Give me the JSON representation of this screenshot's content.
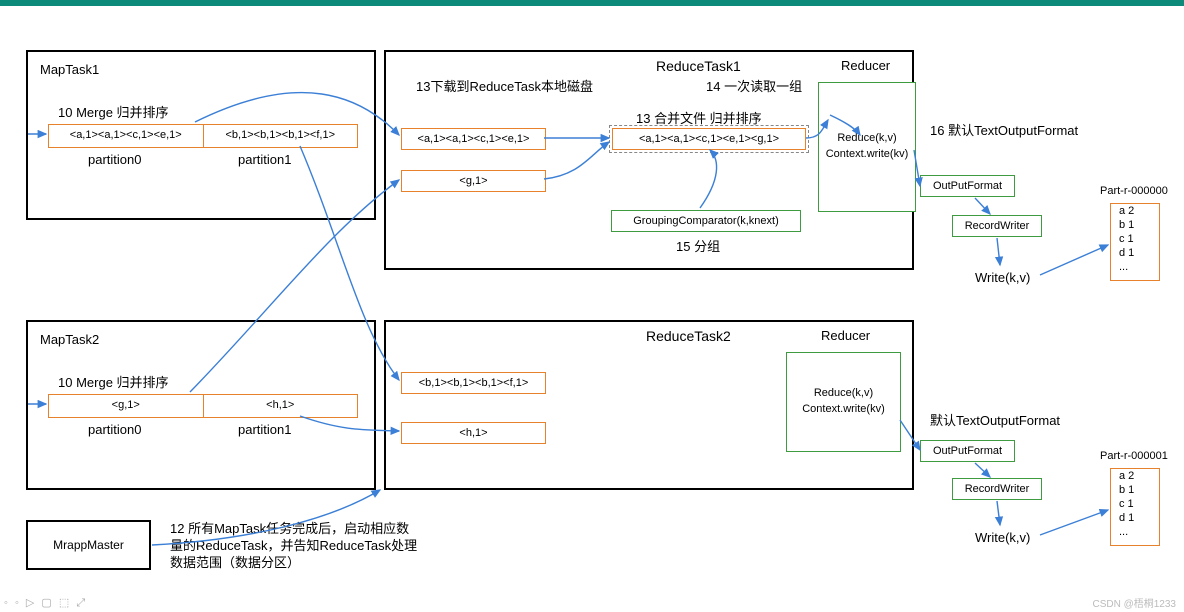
{
  "topbar": {},
  "maptask1": {
    "title": "MapTask1",
    "mergeLabel": "10 Merge 归并排序",
    "partition0": "<a,1><a,1><c,1><e,1>",
    "partition1": "<b,1><b,1><b,1><f,1>",
    "p0Label": "partition0",
    "p1Label": "partition1"
  },
  "maptask2": {
    "title": "MapTask2",
    "mergeLabel": "10 Merge 归并排序",
    "partition0": "<g,1>",
    "partition1": "<h,1>",
    "p0Label": "partition0",
    "p1Label": "partition1"
  },
  "reducetask1": {
    "title": "ReduceTask1",
    "downloadLabel": "13下载到ReduceTask本地磁盘",
    "readGroupLabel": "14 一次读取一组",
    "mergeLabel": "13 合并文件 归并排序",
    "file1": "<a,1><a,1><c,1><e,1>",
    "file2": "<g,1>",
    "merged": "<a,1><a,1><c,1><e,1><g,1>",
    "groupingComparator": "GroupingComparator(k,knext)",
    "groupLabel": "15 分组",
    "reducer": {
      "title": "Reducer",
      "line1": "Reduce(k,v)",
      "line2": "Context.write(kv)"
    },
    "outputDefault": "16 默认TextOutputFormat",
    "outputFormat": "OutPutFormat",
    "recordWriter": "RecordWriter",
    "writekv": "Write(k,v)",
    "partFile": {
      "name": "Part-r-000000",
      "lines": [
        "a 2",
        "b 1",
        "c 1",
        "d 1",
        "..."
      ]
    }
  },
  "reducetask2": {
    "title": "ReduceTask2",
    "file1": "<b,1><b,1><b,1><f,1>",
    "file2": "<h,1>",
    "reducer": {
      "title": "Reducer",
      "line1": "Reduce(k,v)",
      "line2": "Context.write(kv)"
    },
    "outputDefault": "默认TextOutputFormat",
    "outputFormat": "OutPutFormat",
    "recordWriter": "RecordWriter",
    "writekv": "Write(k,v)",
    "partFile": {
      "name": "Part-r-000001",
      "lines": [
        "a 2",
        "b 1",
        "c 1",
        "d 1",
        "..."
      ]
    }
  },
  "master": {
    "title": "MrappMaster",
    "note": "12 所有MapTask任务完成后，启动相应数量的ReduceTask，并告知ReduceTask处理数据范围（数据分区）"
  },
  "watermark": "CSDN @梧桐1233"
}
